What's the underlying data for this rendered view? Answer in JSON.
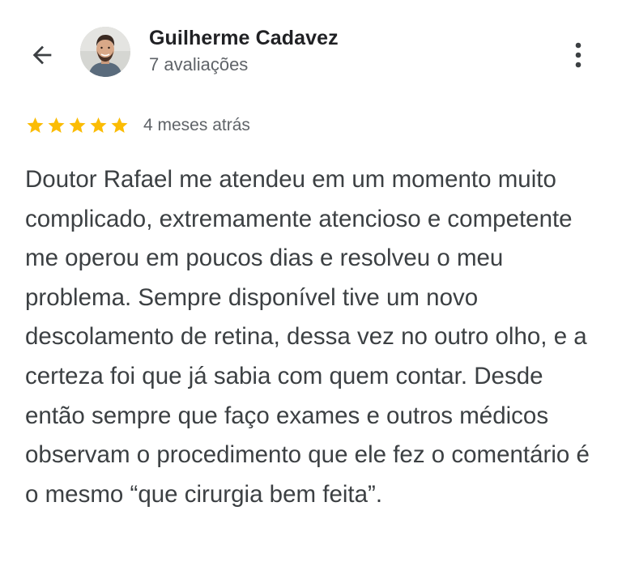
{
  "header": {
    "back_icon": "arrow-back-icon",
    "reviewer_name": "Guilherme Cadavez",
    "review_count": "7 avaliações",
    "more_icon": "more-vert-icon"
  },
  "review": {
    "rating": 5,
    "rating_max": 5,
    "star_color": "#fbbc04",
    "date": "4 meses atrás",
    "text": "Doutor Rafael me atendeu em um momento muito complicado, extremamente atencioso e competente me operou em poucos dias e resolveu o meu problema. Sempre disponível tive um novo descolamento de retina, dessa vez no outro olho, e a certeza foi que já sabia com quem contar. Desde então sempre que faço exames e outros médicos observam o procedimento que ele fez o comentário é o mesmo “que cirurgia bem feita”."
  }
}
